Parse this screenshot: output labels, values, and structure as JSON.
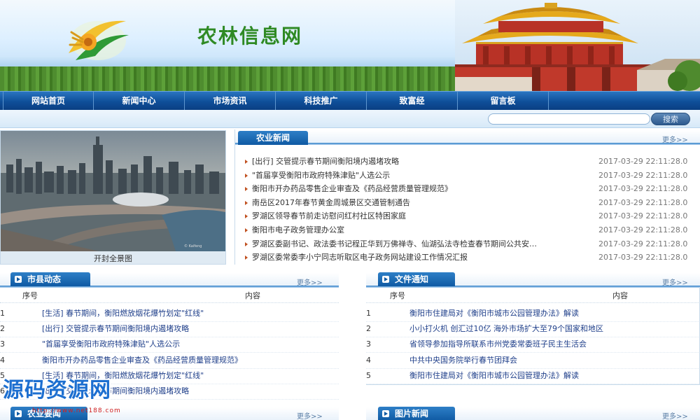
{
  "header": {
    "site_title": "农林信息网",
    "colors": {
      "nav_blue": "#0f4f99",
      "title_green": "#2f8a24",
      "accent_orange": "#c0501f"
    }
  },
  "nav": {
    "items": [
      "网站首页",
      "新闻中心",
      "市场资讯",
      "科技推广",
      "致富经",
      "留言板"
    ]
  },
  "search": {
    "placeholder": "",
    "button_label": "搜索"
  },
  "photo": {
    "caption": "开封全景图"
  },
  "agri_news": {
    "tab_label": "农业新闻",
    "more": "更多>>",
    "items": [
      {
        "title": "[出行] 交管提示春节期间衡阳境内遏堵攻略",
        "date": "2017-03-29 22:11:28.0"
      },
      {
        "title": "\"首届享受衡阳市政府特殊津贴\"人选公示",
        "date": "2017-03-29 22:11:28.0"
      },
      {
        "title": "衡阳市开办药品零售企业审查及《药品经营质量管理规范》",
        "date": "2017-03-29 22:11:28.0"
      },
      {
        "title": "南岳区2017年春节黄金周城景区交通管制通告",
        "date": "2017-03-29 22:11:28.0"
      },
      {
        "title": "罗湖区领导春节前走访慰问红村社区特困家庭",
        "date": "2017-03-29 22:11:28.0"
      },
      {
        "title": "衡阳市电子政务管理办公室",
        "date": "2017-03-29 22:11:28.0"
      },
      {
        "title": "罗湖区委副书记、政法委书记程正华到万佛禅寺、仙湖弘法寺检查春节期间公共安…",
        "date": "2017-03-29 22:11:28.0"
      },
      {
        "title": "罗湖区委常委李小宁同志听取区电子政务网站建设工作情况汇报",
        "date": "2017-03-29 22:11:28.0"
      }
    ]
  },
  "county_news": {
    "tab_label": "市县动态",
    "more": "更多>>",
    "col_num": "序号",
    "col_content": "内容",
    "rows": [
      {
        "num": "1",
        "text": "[生活] 春节期间，衡阳燃放烟花爆竹划定\"红线\""
      },
      {
        "num": "2",
        "text": "[出行] 交管提示春节期间衡阳境内遏堵攻略"
      },
      {
        "num": "3",
        "text": "\"首届享受衡阳市政府特殊津贴\"人选公示"
      },
      {
        "num": "4",
        "text": "衡阳市开办药品零售企业审查及《药品经营质量管理规范》"
      },
      {
        "num": "5",
        "text": "[生活] 春节期间，衡阳燃放烟花爆竹划定\"红线\""
      },
      {
        "num": "6",
        "text": "[出行] 交管提示春节期间衡阳境内遏堵攻略"
      }
    ]
  },
  "doc_notice": {
    "tab_label": "文件通知",
    "more": "更多>>",
    "col_num": "序号",
    "col_content": "内容",
    "rows": [
      {
        "num": "1",
        "text": "衡阳市住建局对《衡阳市城市公园管理办法》解读"
      },
      {
        "num": "2",
        "text": "小小打火机 创汇过10亿 海外市场扩大至79个国家和地区"
      },
      {
        "num": "3",
        "text": "省领导参加指导所联系市州党委常委班子民主生活会"
      },
      {
        "num": "4",
        "text": "中共中央国务院举行春节团拜会"
      },
      {
        "num": "5",
        "text": "衡阳市住建局对《衡阳市城市公园管理办法》解读"
      }
    ]
  },
  "agri_guide": {
    "tab_label": "农业要闻",
    "more": "更多>>"
  },
  "photo_news": {
    "tab_label": "图片新闻",
    "more": "更多>>"
  },
  "watermark": {
    "title": "源码资源网",
    "url": "http://www.net188.com"
  }
}
